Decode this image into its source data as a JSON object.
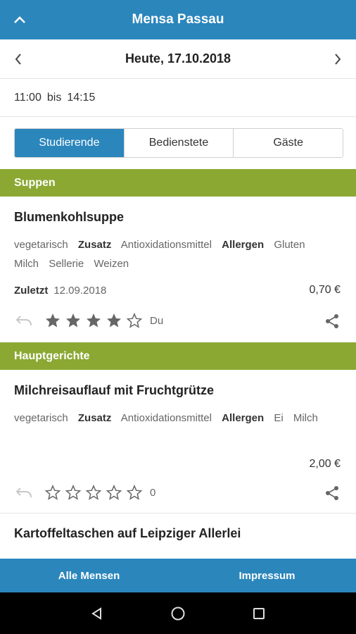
{
  "app": {
    "title": "Mensa Passau"
  },
  "date_nav": {
    "date": "Heute, 17.10.2018"
  },
  "hours": {
    "from": "11:00",
    "sep": "bis",
    "to": "14:15"
  },
  "segments": [
    {
      "label": "Studierende",
      "active": true
    },
    {
      "label": "Bedienstete",
      "active": false
    },
    {
      "label": "Gäste",
      "active": false
    }
  ],
  "sections": [
    {
      "title": "Suppen"
    },
    {
      "title": "Hauptgerichte"
    }
  ],
  "meals": [
    {
      "name": "Blumenkohlsuppe",
      "tag_vegetarian": "vegetarisch",
      "label_zusatz": "Zusatz",
      "zusatz": "Antioxidationsmittel",
      "label_allergen": "Allergen",
      "allergens": [
        "Gluten",
        "Milch",
        "Sellerie",
        "Weizen"
      ],
      "last_label": "Zuletzt",
      "last_date": "12.09.2018",
      "price": "0,70 €",
      "rating": 4,
      "rating_label": "Du"
    },
    {
      "name": "Milchreisauflauf mit Fruchtgrütze",
      "tag_vegetarian": "vegetarisch",
      "label_zusatz": "Zusatz",
      "zusatz": "Antioxidationsmittel",
      "label_allergen": "Allergen",
      "allergens": [
        "Ei",
        "Milch"
      ],
      "price": "2,00 €",
      "rating": 0,
      "rating_label": "0"
    },
    {
      "name": "Kartoffeltaschen auf Leipziger Allerlei"
    }
  ],
  "bottom_tabs": [
    {
      "label": "Alle Mensen"
    },
    {
      "label": "Impressum"
    }
  ],
  "colors": {
    "primary": "#2B86BC",
    "section": "#8BA832"
  },
  "icons": {
    "collapse": "chevron-up-icon",
    "prev": "chevron-left-icon",
    "next": "chevron-right-icon",
    "undo": "undo-icon",
    "star": "star-icon",
    "share": "share-icon",
    "back": "back-triangle-icon",
    "home": "home-circle-icon",
    "recents": "recents-square-icon"
  }
}
